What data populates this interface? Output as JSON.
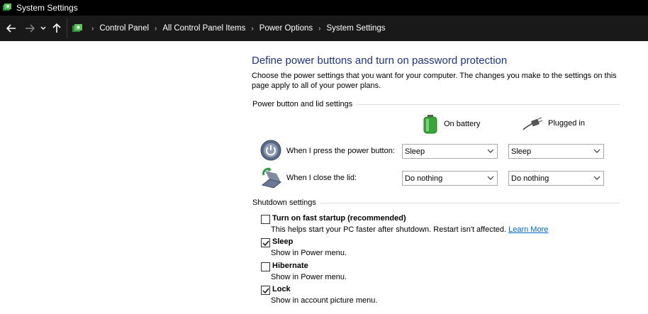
{
  "window": {
    "title": "System Settings"
  },
  "nav": {
    "breadcrumbs": [
      "Control Panel",
      "All Control Panel Items",
      "Power Options",
      "System Settings"
    ]
  },
  "page": {
    "heading": "Define power buttons and turn on password protection",
    "description": "Choose the power settings that you want for your computer. The changes you make to the settings on this page apply to all of your power plans."
  },
  "power_group": {
    "label": "Power button and lid settings",
    "col_battery": "On battery",
    "col_plugged": "Plugged in",
    "rows": [
      {
        "label": "When I press the power button:",
        "battery": "Sleep",
        "plugged": "Sleep"
      },
      {
        "label": "When I close the lid:",
        "battery": "Do nothing",
        "plugged": "Do nothing"
      }
    ]
  },
  "shutdown_group": {
    "label": "Shutdown settings",
    "items": [
      {
        "title": "Turn on fast startup (recommended)",
        "sub": "This helps start your PC faster after shutdown. Restart isn't affected.",
        "link": "Learn More",
        "checked": false
      },
      {
        "title": "Sleep",
        "sub": "Show in Power menu.",
        "checked": true
      },
      {
        "title": "Hibernate",
        "sub": "Show in Power menu.",
        "checked": false
      },
      {
        "title": "Lock",
        "sub": "Show in account picture menu.",
        "checked": true
      }
    ]
  },
  "colors": {
    "heading": "#1e3287",
    "link": "#0066cc",
    "titlebar": "#000000",
    "navbar": "#191919"
  }
}
